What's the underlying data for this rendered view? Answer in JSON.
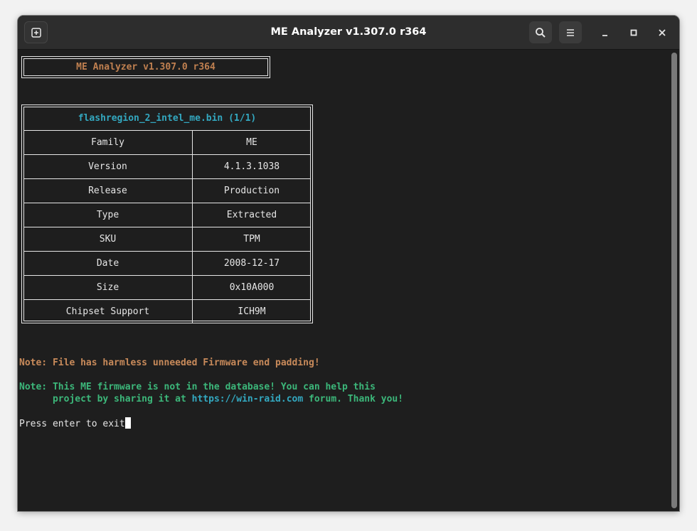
{
  "window": {
    "title": "ME Analyzer v1.307.0 r364",
    "icons": {
      "new_tab": "new-tab-icon",
      "search": "search-icon",
      "menu": "hamburger-menu-icon",
      "minimize": "minimize-icon",
      "maximize": "maximize-icon",
      "close": "close-icon"
    }
  },
  "terminal": {
    "header": "ME Analyzer v1.307.0 r364",
    "table": {
      "title": "flashregion_2_intel_me.bin (1/1)",
      "rows": [
        {
          "key": "Family",
          "value": "ME"
        },
        {
          "key": "Version",
          "value": "4.1.3.1038"
        },
        {
          "key": "Release",
          "value": "Production"
        },
        {
          "key": "Type",
          "value": "Extracted"
        },
        {
          "key": "SKU",
          "value": "TPM"
        },
        {
          "key": "Date",
          "value": "2008-12-17"
        },
        {
          "key": "Size",
          "value": "0x10A000"
        },
        {
          "key": "Chipset Support",
          "value": "ICH9M"
        }
      ]
    },
    "note1": "Note: File has harmless unneeded Firmware end padding!",
    "note2_line1": "Note: This ME firmware is not in the database! You can help this",
    "note2_line2_prefix": "      project by sharing it at ",
    "note2_link": "https://win-raid.com",
    "note2_line2_suffix": " forum. Thank you!",
    "prompt": "Press enter to exit"
  },
  "colors": {
    "background": "#1e1e1e",
    "header_text": "#c08050",
    "table_title": "#33a8c0",
    "note_warning": "#c88a5a",
    "note_info": "#3cb77a",
    "link": "#33a8c0"
  }
}
